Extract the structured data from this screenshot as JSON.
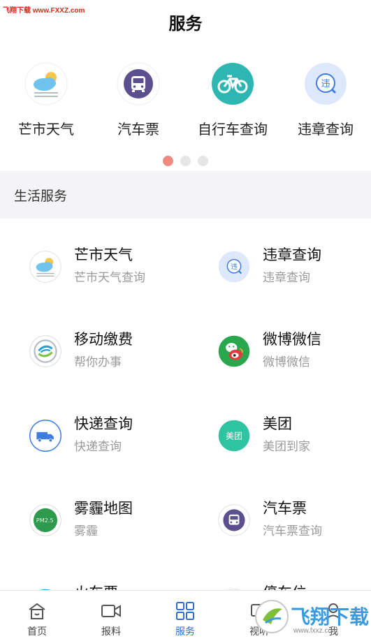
{
  "watermark_top": "飞翔下载 www.FXXZ.com",
  "header": {
    "title": "服务"
  },
  "shortcuts": [
    {
      "label": "芒市天气",
      "icon": "weather-icon"
    },
    {
      "label": "汽车票",
      "icon": "bus-icon"
    },
    {
      "label": "自行车查询",
      "icon": "bicycle-icon"
    },
    {
      "label": "违章查询",
      "icon": "violation-icon"
    }
  ],
  "carousel": {
    "pages": 3,
    "active": 0
  },
  "section": {
    "title": "生活服务"
  },
  "services": [
    {
      "name": "芒市天气",
      "desc": "芒市天气查询",
      "icon": "weather-icon"
    },
    {
      "name": "违章查询",
      "desc": "违章查询",
      "icon": "violation-icon"
    },
    {
      "name": "移动缴费",
      "desc": "帮你办事",
      "icon": "china-mobile-icon"
    },
    {
      "name": "微博微信",
      "desc": "微博微信",
      "icon": "weibo-wechat-icon"
    },
    {
      "name": "快递查询",
      "desc": "快递查询",
      "icon": "delivery-truck-icon"
    },
    {
      "name": "美团",
      "desc": "美团到家",
      "icon": "meituan-icon",
      "icon_text": "美团"
    },
    {
      "name": "雾霾地图",
      "desc": "雾霾",
      "icon": "pm25-icon",
      "icon_text": "PM2.5"
    },
    {
      "name": "汽车票",
      "desc": "汽车票查询",
      "icon": "bus-icon"
    },
    {
      "name": "火车票",
      "desc": "",
      "icon": "train-icon"
    },
    {
      "name": "停车位",
      "desc": "",
      "icon": "parking-icon"
    }
  ],
  "tabs": [
    {
      "label": "首页",
      "icon": "home-icon",
      "active": false
    },
    {
      "label": "报料",
      "icon": "video-camera-icon",
      "active": false
    },
    {
      "label": "服务",
      "icon": "grid-icon",
      "active": true
    },
    {
      "label": "视听",
      "icon": "tv-icon",
      "active": false
    },
    {
      "label": "我",
      "icon": "user-icon",
      "active": false
    }
  ],
  "watermark_bottom": {
    "text": "飞翔下载",
    "url": "www.fxxz.com"
  },
  "colors": {
    "accent": "#2b6fd0",
    "bicycle": "#2eb6b3",
    "bus": "#5b4f8f",
    "violation_bg": "#dde8fb",
    "meituan": "#2fc4a0",
    "pm": "#2e9a4e",
    "dot_active": "#ef8a80"
  }
}
